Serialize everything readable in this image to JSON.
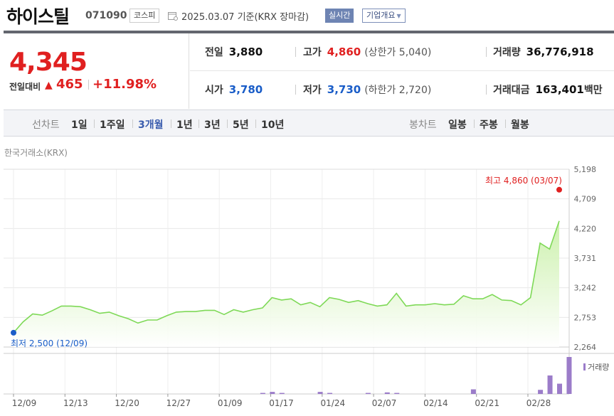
{
  "header": {
    "stock_name": "하이스틸",
    "stock_code": "071090",
    "market": "코스피",
    "date_text": "2025.03.07 기준(KRX 장마감)",
    "realtime_label": "실시간",
    "company_label": "기업개요"
  },
  "price": {
    "current": "4,345",
    "change_label": "전일대비",
    "change_value": "465",
    "change_pct": "+11.98%"
  },
  "stats": {
    "prev_close_label": "전일",
    "prev_close": "3,880",
    "high_label": "고가",
    "high": "4,860",
    "upper_limit_label": "(상한가",
    "upper_limit": "5,040)",
    "volume_label": "거래량",
    "volume": "36,776,918",
    "open_label": "시가",
    "open": "3,780",
    "low_label": "저가",
    "low": "3,730",
    "lower_limit_label": "(하한가",
    "lower_limit": "2,720)",
    "trade_value_label": "거래대금",
    "trade_value": "163,401",
    "trade_value_unit": "백만"
  },
  "tabs": {
    "line_label": "선차트",
    "line_items": [
      "1일",
      "1주일",
      "3개월",
      "1년",
      "3년",
      "5년",
      "10년"
    ],
    "active_line": "3개월",
    "candle_label": "봉차트",
    "candle_items": [
      "일봉",
      "주봉",
      "월봉"
    ]
  },
  "exchange_label": "한국거래소(KRX)",
  "colors": {
    "up": "#e02020",
    "down": "#1a5dc8",
    "line": "#7ed957",
    "area_top": "#c9f0a8",
    "volume_bar": "#9b7cc9"
  },
  "chart_data": {
    "type": "area",
    "x_ticks": [
      "12/09",
      "12/13",
      "12/20",
      "12/27",
      "01/09",
      "01/17",
      "01/24",
      "02/07",
      "02/14",
      "02/21",
      "02/28"
    ],
    "y_ticks": [
      2264,
      2753,
      3242,
      3731,
      4220,
      4709,
      5198
    ],
    "ylim": [
      2264,
      5198
    ],
    "max_annotation": "최고 4,860 (03/07)",
    "min_annotation": "최저 2,500 (12/09)",
    "volume_legend": "거래량",
    "prices": [
      2500,
      2680,
      2810,
      2790,
      2860,
      2940,
      2940,
      2930,
      2880,
      2820,
      2840,
      2780,
      2730,
      2660,
      2710,
      2710,
      2780,
      2840,
      2850,
      2850,
      2870,
      2870,
      2800,
      2880,
      2840,
      2880,
      2910,
      3080,
      3040,
      3060,
      2960,
      3000,
      2930,
      3080,
      3050,
      3000,
      3030,
      2980,
      2940,
      2960,
      3150,
      2940,
      2960,
      2960,
      2980,
      2960,
      2970,
      3110,
      3060,
      3060,
      3130,
      3040,
      3030,
      2960,
      3080,
      3980,
      3880,
      4345
    ],
    "volume": [
      0,
      0,
      0,
      0,
      0,
      0,
      0,
      0,
      0,
      0,
      0,
      0,
      0,
      0,
      0,
      0,
      0,
      0,
      0,
      0,
      0,
      0,
      0,
      0,
      0,
      0,
      0.2,
      0.4,
      0.2,
      0,
      0,
      0,
      0.4,
      0.2,
      0,
      0,
      0,
      0.2,
      0,
      0.3,
      0.2,
      0,
      0,
      0,
      0,
      0,
      0,
      0,
      0.9,
      0,
      0,
      0,
      0,
      0,
      0,
      0.8,
      3.6,
      2.0,
      7.2
    ]
  }
}
